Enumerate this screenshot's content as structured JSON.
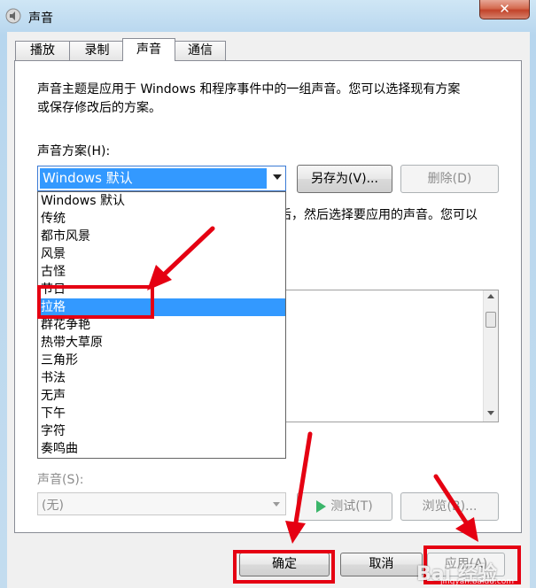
{
  "window": {
    "title": "声音",
    "close_label": "✕"
  },
  "tabs": [
    {
      "label": "播放"
    },
    {
      "label": "录制"
    },
    {
      "label": "声音"
    },
    {
      "label": "通信"
    }
  ],
  "description": {
    "line1": "声音主题是应用于 Windows 和程序事件中的一组声音。您可以选择现有方案",
    "line2": "或保存修改后的方案。"
  },
  "scheme": {
    "label": "声音方案(H):",
    "selected": "Windows 默认",
    "save_as_label": "另存为(V)...",
    "delete_label": "删除(D)",
    "partially_hidden_text": "后，然后选择要应用的声音。您可以",
    "options": [
      "Windows 默认",
      "传统",
      "都市风景",
      "风景",
      "古怪",
      "节日",
      "拉格",
      "群花争艳",
      "热带大草原",
      "三角形",
      "书法",
      "无声",
      "下午",
      "字符",
      "奏鸣曲"
    ],
    "highlighted_option": "拉格"
  },
  "sound": {
    "label": "声音(S):",
    "selected": "(无)",
    "test_label": "测试(T)",
    "browse_label": "浏览(B)..."
  },
  "buttons": {
    "ok": "确定",
    "cancel": "取消",
    "apply": "应用(A)"
  },
  "watermark": {
    "text": "Bai 经验",
    "sub": "jingyan.baidu.com"
  },
  "colors": {
    "highlight": "#3399ff",
    "annotation": "#e50012"
  }
}
